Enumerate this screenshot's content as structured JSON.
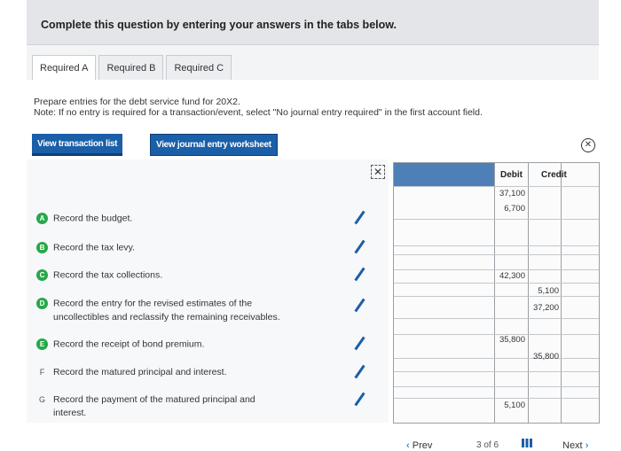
{
  "header": {
    "title": "Complete this question by entering your answers in the tabs below."
  },
  "tabs": [
    {
      "label": "Required A"
    },
    {
      "label": "Required B"
    },
    {
      "label": "Required C"
    }
  ],
  "instructions": {
    "line1": "Prepare entries for the debt service fund for 20X2.",
    "line2": "Note: If no entry is required for a transaction/event, select \"No journal entry required\" in the first account field."
  },
  "buttons": {
    "view_transaction_list": "View transaction list",
    "view_journal_entry_worksheet": "View journal entry worksheet"
  },
  "transactions": [
    {
      "badge": "A",
      "text": "Record the budget.",
      "badge_color": "#27a84a"
    },
    {
      "badge": "B",
      "text": "Record the tax levy.",
      "badge_color": "#27a84a"
    },
    {
      "badge": "C",
      "text": "Record the tax collections.",
      "badge_color": "#27a84a"
    },
    {
      "badge": "D",
      "text": "Record the entry for the revised estimates of the",
      "text2": "uncollectibles and reclassify the remaining receivables.",
      "badge_color": "#27a84a"
    },
    {
      "badge": "E",
      "text": "Record the receipt of bond premium.",
      "badge_color": "#27a84a"
    },
    {
      "badge": "F",
      "text": "Record the matured principal and interest."
    },
    {
      "badge": "G",
      "text": "Record the payment of the matured principal and",
      "text2": "interest."
    }
  ],
  "grid": {
    "debit_header": "Debit",
    "credit_header": "Credit",
    "cells": [
      {
        "col": "debit",
        "value": "37,100"
      },
      {
        "col": "debit",
        "value": "6,700"
      },
      {
        "col": "debit",
        "value": "42,300"
      },
      {
        "col": "credit",
        "value": "5,100"
      },
      {
        "col": "credit",
        "value": "37,200"
      },
      {
        "col": "debit",
        "value": "35,800"
      },
      {
        "col": "credit",
        "value": "35,800"
      },
      {
        "col": "debit",
        "value": "5,100"
      }
    ]
  },
  "footer": {
    "prev": "Prev",
    "page_current": "3",
    "page_of": "of",
    "page_total": "6",
    "page_text": "3 of 6",
    "next": "Next"
  },
  "colors": {
    "accent": "#1a5fa8",
    "grid_header": "#4e7fb7",
    "badge_green": "#27a84a"
  },
  "icons": [
    "close-icon",
    "pencil-icon",
    "checkbox-x-icon",
    "grid-icon",
    "chevron-left-icon",
    "chevron-right-icon"
  ]
}
